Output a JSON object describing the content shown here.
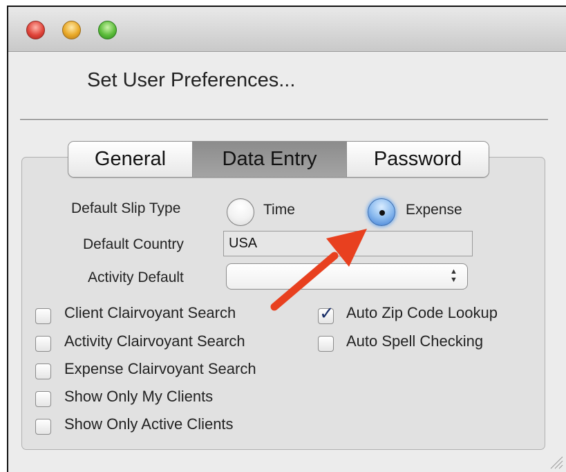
{
  "window": {
    "heading": "Set User Preferences..."
  },
  "tabs": [
    {
      "label": "General",
      "selected": false
    },
    {
      "label": "Data Entry",
      "selected": true
    },
    {
      "label": "Password",
      "selected": false
    }
  ],
  "slip_type": {
    "label": "Default Slip Type",
    "options": [
      {
        "label": "Time",
        "selected": false
      },
      {
        "label": "Expense",
        "selected": true
      }
    ]
  },
  "country": {
    "label": "Default Country",
    "value": "USA"
  },
  "activity": {
    "label": "Activity Default",
    "value": "",
    "icon": "updown-arrows-icon"
  },
  "checkboxes_left": [
    {
      "label": "Client Clairvoyant Search",
      "checked": false
    },
    {
      "label": "Activity Clairvoyant Search",
      "checked": false
    },
    {
      "label": "Expense Clairvoyant Search",
      "checked": false
    },
    {
      "label": "Show Only My Clients",
      "checked": false
    },
    {
      "label": "Show Only Active Clients",
      "checked": false
    }
  ],
  "checkboxes_right": [
    {
      "label": "Auto Zip Code Lookup",
      "checked": true
    },
    {
      "label": "Auto Spell Checking",
      "checked": false
    }
  ],
  "annotation": {
    "icon": "red-arrow-icon",
    "color": "#e8401f"
  },
  "colors": {
    "selected_tab": "#979797",
    "radio_selected": "#3c7bd3",
    "checkmark": "#1a2f68"
  }
}
